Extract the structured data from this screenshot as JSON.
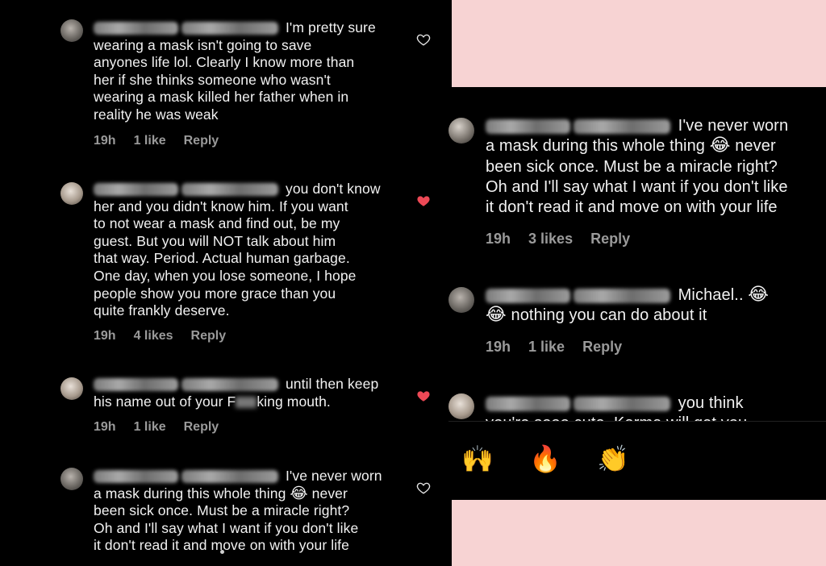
{
  "left_thread": {
    "comments": [
      {
        "text_lines": [
          "I'm pretty sure",
          "wearing a mask isn't going to save",
          "anyones life lol. Clearly I know more than",
          "her if she thinks someone who wasn't",
          "wearing a mask killed her father when in",
          "reality he was weak"
        ],
        "time": "19h",
        "likes": "1 like",
        "reply": "Reply",
        "liked": false
      },
      {
        "text_lines": [
          "you don't know",
          "her and you didn't know him. If you want",
          "to not wear a mask and find out, be my",
          "guest. But you will NOT talk about him",
          "that way. Period. Actual human garbage.",
          "One day, when you lose someone, I hope",
          "people show you more grace than you",
          "quite frankly deserve."
        ],
        "time": "19h",
        "likes": "4 likes",
        "reply": "Reply",
        "liked": true
      },
      {
        "text_lines": [
          "until then keep",
          "his name out of your F",
          "king mouth."
        ],
        "time": "19h",
        "likes": "1 like",
        "reply": "Reply",
        "liked": true
      },
      {
        "text_lines": [
          "I've never worn",
          "a mask during this whole thing",
          "never",
          "been sick once. Must be a miracle right?",
          "Oh and I'll say what I want if you don't like",
          "it don't read it and move on with your life"
        ],
        "liked": false
      }
    ]
  },
  "right_thread": {
    "comments": [
      {
        "text_lines": [
          "I've never worn",
          "a mask during this whole thing",
          "never",
          "been sick once. Must be a miracle right?",
          "Oh and I'll say what I want if you don't like",
          "it don't read it and move on with your life"
        ],
        "time": "19h",
        "likes": "3 likes",
        "reply": "Reply"
      },
      {
        "text_lines": [
          "Michael..",
          "nothing you can do about it"
        ],
        "time": "19h",
        "likes": "1 like",
        "reply": "Reply"
      },
      {
        "text_lines": [
          "you think",
          "you're sooo cute. Karma will get you"
        ]
      }
    ]
  },
  "icons": {
    "laugh": "😂",
    "reactions": [
      "🙌",
      "🔥",
      "👏",
      "😢",
      "😍",
      "😮"
    ]
  },
  "colors": {
    "heart_active": "#ed4956",
    "background": "#f7d3d3"
  }
}
